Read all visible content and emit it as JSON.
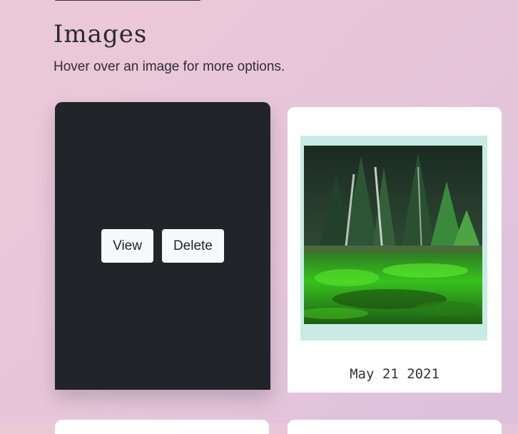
{
  "header": {
    "title": "Images",
    "subtitle": "Hover over an image for more options."
  },
  "cards": [
    {
      "state": "hover",
      "actions": {
        "view_label": "View",
        "delete_label": "Delete"
      }
    },
    {
      "date": "May 21 2021",
      "mat_color": "#c8ebe5",
      "photo_subject": "forest lake with green algae"
    }
  ],
  "colors": {
    "overlay": "#212429",
    "button_bg": "#f8f9fa"
  }
}
